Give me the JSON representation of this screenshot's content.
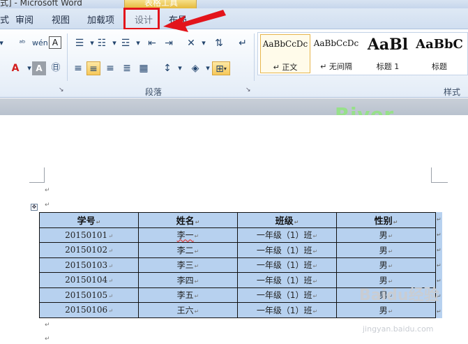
{
  "window": {
    "title": "式] - Microsoft Word",
    "context_tab_header": "表格工具"
  },
  "tabs": {
    "partial": "式",
    "review": "审阅",
    "view": "视图",
    "addins": "加载项",
    "design": "设计",
    "layout": "布局"
  },
  "ribbon": {
    "group_paragraph": "段落",
    "group_styles": "样式",
    "styles": [
      {
        "sample": "AaBbCcDc",
        "name": "↵ 正文",
        "selected": true
      },
      {
        "sample": "AaBbCcDc",
        "name": "↵ 无间隔",
        "selected": false
      },
      {
        "sample": "AaBl",
        "name": "标题 1",
        "selected": false
      },
      {
        "sample": "AaBbC",
        "name": "标题",
        "selected": false
      }
    ]
  },
  "annotation": {
    "watermark": "River",
    "highlight_color": "#e3141b"
  },
  "table": {
    "headers": [
      "学号",
      "姓名",
      "班级",
      "性别"
    ],
    "rows": [
      [
        "20150101",
        "李一",
        "一年级（1）班",
        "男"
      ],
      [
        "20150102",
        "李二",
        "一年级（1）班",
        "男"
      ],
      [
        "20150103",
        "李三",
        "一年级（1）班",
        "男"
      ],
      [
        "20150104",
        "李四",
        "一年级（1）班",
        "男"
      ],
      [
        "20150105",
        "李五",
        "一年级（1）班",
        "男"
      ],
      [
        "20150106",
        "王六",
        "一年级（1）班",
        "男"
      ]
    ],
    "cell_background": "#b7d1ef"
  },
  "brand": {
    "logo": "Baidu经验",
    "url": "jingyan.baidu.com"
  }
}
